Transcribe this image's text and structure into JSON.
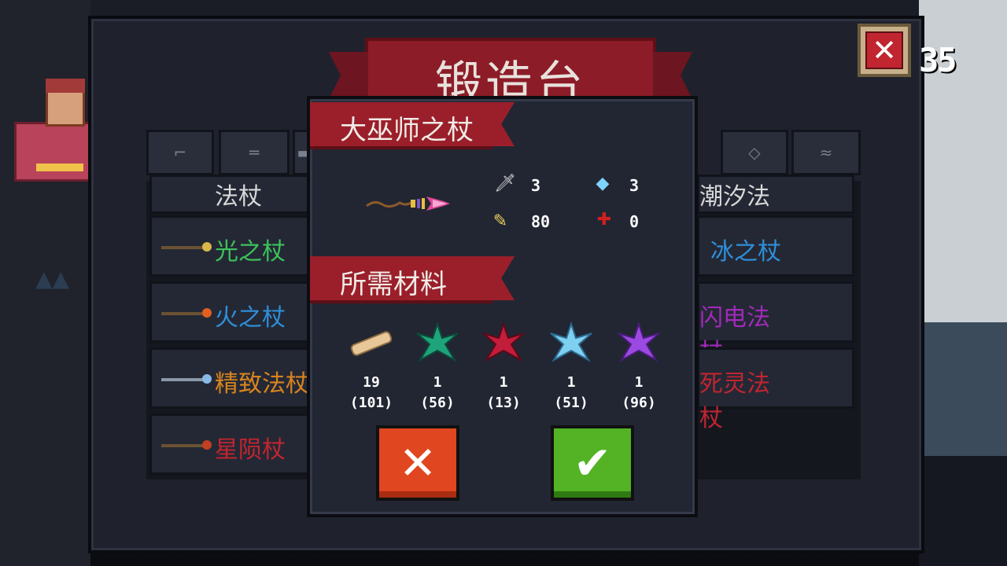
{
  "background": {
    "score": "35"
  },
  "panel": {
    "title": "锻造台",
    "close_icon": "close-icon"
  },
  "tabs": [
    {
      "icon": "pistol-icon",
      "glyph": "⌐"
    },
    {
      "icon": "rifle-icon",
      "glyph": "═"
    },
    {
      "icon": "weapon-icon",
      "glyph": "▬"
    },
    {
      "icon": "bow-icon",
      "glyph": "◇"
    },
    {
      "icon": "fish-icon",
      "glyph": "≈"
    }
  ],
  "list": {
    "left": [
      {
        "label": "法杖",
        "color": "#d8d8d8"
      },
      {
        "label": "光之杖",
        "color": "#3cc25a"
      },
      {
        "label": "火之杖",
        "color": "#2e8fd8"
      },
      {
        "label": "精致法杖",
        "color": "#d8841e"
      },
      {
        "label": "星陨杖",
        "color": "#c02530"
      }
    ],
    "right": [
      {
        "label": "潮汐法杖",
        "color": "#d8d8d8"
      },
      {
        "label": "冰之杖",
        "color": "#2e8fd8"
      },
      {
        "label": "闪电法杖",
        "color": "#a02ab8"
      },
      {
        "label": "死灵法杖",
        "color": "#c02530"
      }
    ]
  },
  "modal": {
    "item_name": "大巫师之杖",
    "item_icon": "wand-icon",
    "stats": {
      "damage": "3",
      "energy": "3",
      "crit": "80",
      "accuracy": "0"
    },
    "materials_title": "所需材料",
    "materials": [
      {
        "icon": "timber-icon",
        "need": "19",
        "have": "(101)"
      },
      {
        "icon": "green-crystal-icon",
        "need": "1",
        "have": "(56)"
      },
      {
        "icon": "red-crystal-icon",
        "need": "1",
        "have": "(13)"
      },
      {
        "icon": "blue-crystal-icon",
        "need": "1",
        "have": "(51)"
      },
      {
        "icon": "purple-crystal-icon",
        "need": "1",
        "have": "(96)"
      }
    ],
    "cancel_glyph": "✕",
    "confirm_glyph": "✔"
  }
}
